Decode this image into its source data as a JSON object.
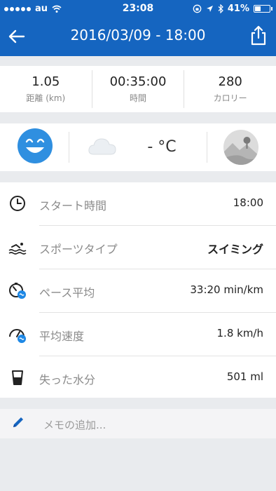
{
  "status_bar": {
    "carrier": "au",
    "time": "23:08",
    "battery_text": "41%",
    "battery_level": 0.41
  },
  "header": {
    "title": "2016/03/09 - 18:00",
    "back_icon": "arrow-left-icon",
    "share_icon": "share-icon"
  },
  "summary": [
    {
      "value": "1.05",
      "label": "距離 (km)"
    },
    {
      "value": "00:35:00",
      "label": "時間"
    },
    {
      "value": "280",
      "label": "カロリー"
    }
  ],
  "conditions": {
    "mood_icon": "smiley-face-icon",
    "weather_icon": "cloud-icon",
    "temperature": "- °C",
    "terrain_icon": "landscape-icon"
  },
  "details": [
    {
      "icon": "clock-icon",
      "label": "スタート時間",
      "value": "18:00"
    },
    {
      "icon": "swimming-icon",
      "label": "スポーツタイプ",
      "value": "スイミング"
    },
    {
      "icon": "pace-icon",
      "label": "ペース平均",
      "value": "33:20 min/km"
    },
    {
      "icon": "speed-icon",
      "label": "平均速度",
      "value": "1.8 km/h"
    },
    {
      "icon": "water-glass-icon",
      "label": "失った水分",
      "value": "501 ml"
    }
  ],
  "memo": {
    "placeholder": "メモの追加...",
    "icon": "pencil-icon"
  },
  "colors": {
    "primary": "#1565c0",
    "mood": "#2f8fe0",
    "badge": "#1e88e5"
  }
}
